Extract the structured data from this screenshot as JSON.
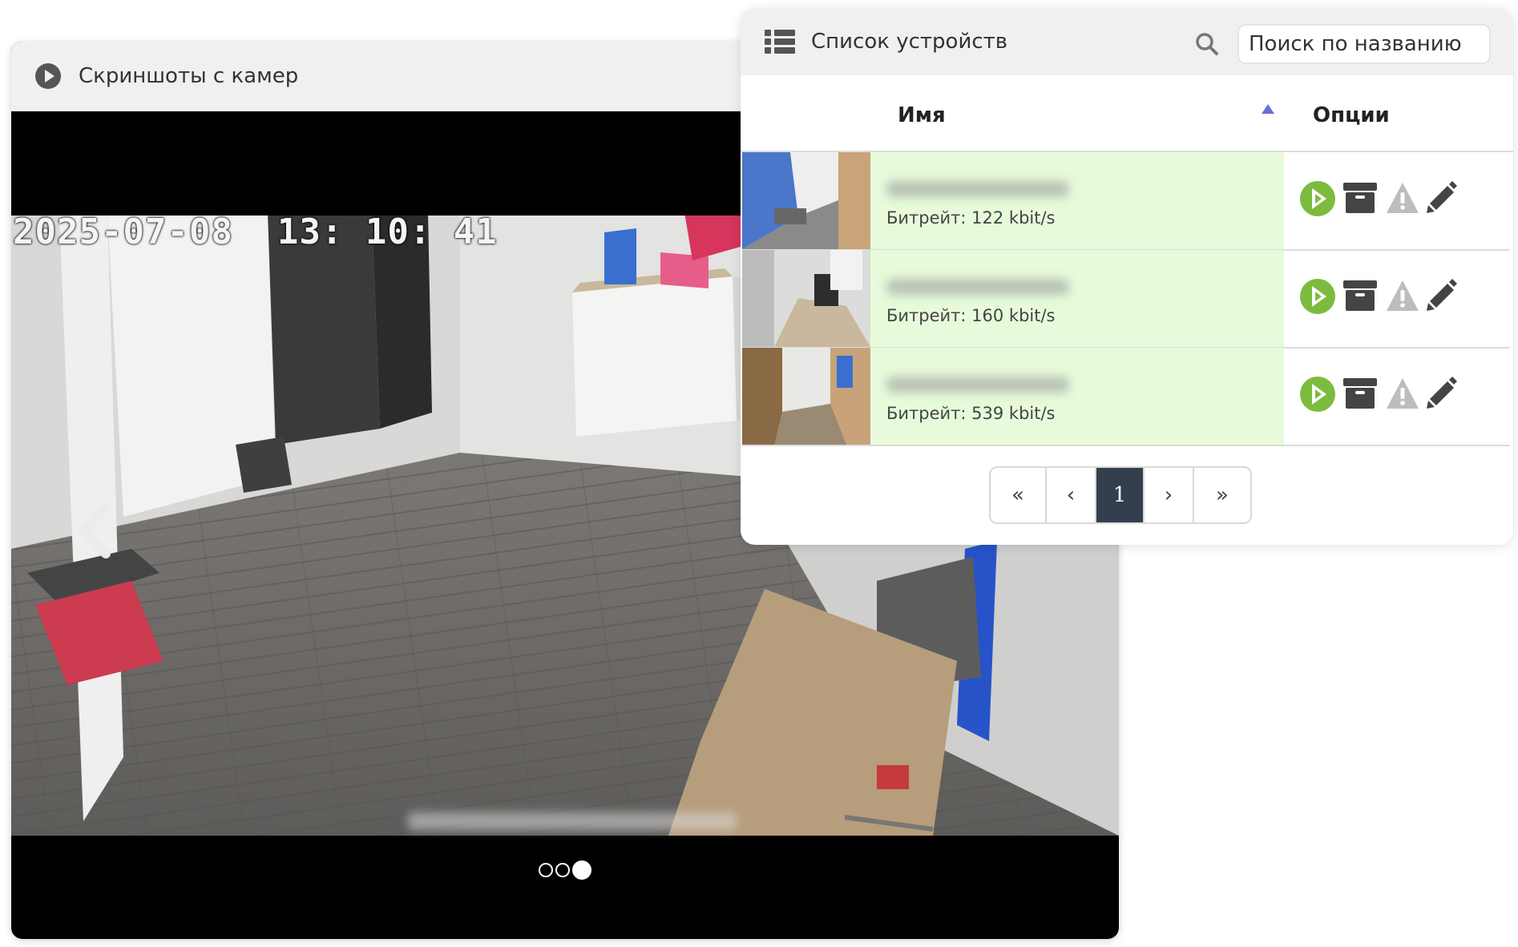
{
  "camera_panel": {
    "title": "Скриншоты с камер",
    "timestamp": "2025-07-08  13: 10: 41",
    "slides": {
      "count": 3,
      "active_index": 3
    }
  },
  "device_panel": {
    "title": "Список устройств",
    "search": {
      "placeholder": "Поиск по названию",
      "value": ""
    },
    "columns": {
      "name": "Имя",
      "options": "Опции"
    },
    "devices": [
      {
        "bitrate": "Битрейт: 122 kbit/s"
      },
      {
        "bitrate": "Битрейт: 160 kbit/s"
      },
      {
        "bitrate": "Битрейт: 539 kbit/s"
      }
    ],
    "pagination": {
      "first": "«",
      "prev": "‹",
      "current": "1",
      "next": "›",
      "last": "»"
    }
  },
  "colors": {
    "row_bg": "#e7fbdb",
    "play_green": "#7dbb3f",
    "sort_arrow": "#6a6fd6",
    "current_page_bg": "#333f4d"
  },
  "icons": [
    "play-circle-icon",
    "list-icon",
    "search-icon",
    "chevron-left-icon",
    "archive-icon",
    "warning-icon",
    "pencil-icon"
  ]
}
